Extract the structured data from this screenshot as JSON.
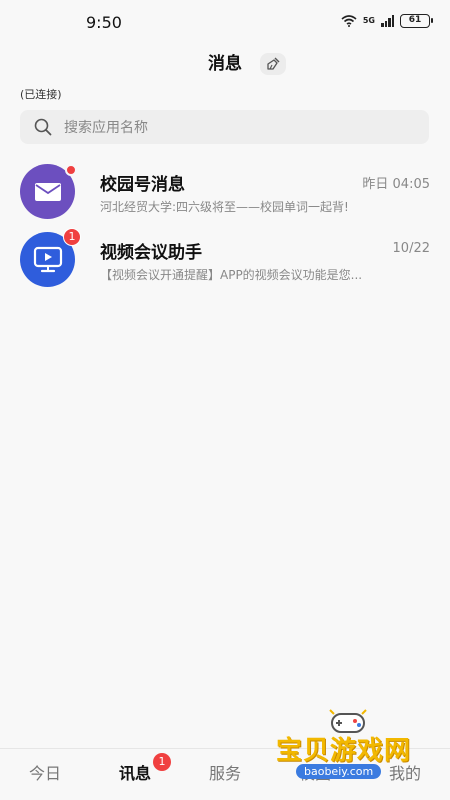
{
  "status_bar": {
    "time": "9:50",
    "network": "5G",
    "battery": "61"
  },
  "header": {
    "title": "消息"
  },
  "connection": {
    "status": "(已连接)"
  },
  "search": {
    "placeholder": "搜索应用名称"
  },
  "messages": [
    {
      "title": "校园号消息",
      "time": "昨日 04:05",
      "preview": "河北经贸大学:四六级将至——校园单词一起背!",
      "badge": "",
      "icon": "envelope-icon"
    },
    {
      "title": "视频会议助手",
      "time": "10/22",
      "preview": "【视频会议开通提醒】APP的视频会议功能是您...",
      "badge": "1",
      "icon": "video-screen-icon"
    }
  ],
  "tabs": [
    {
      "label": "今日"
    },
    {
      "label": "讯息",
      "badge": "1"
    },
    {
      "label": "服务"
    },
    {
      "label": "校园"
    },
    {
      "label": "我的"
    }
  ],
  "watermark": {
    "text": "宝贝游戏网",
    "url": "baobeiy.com"
  },
  "colors": {
    "accent_purple": "#6c4fbf",
    "accent_blue": "#2f5ddc",
    "badge_red": "#f04040"
  }
}
